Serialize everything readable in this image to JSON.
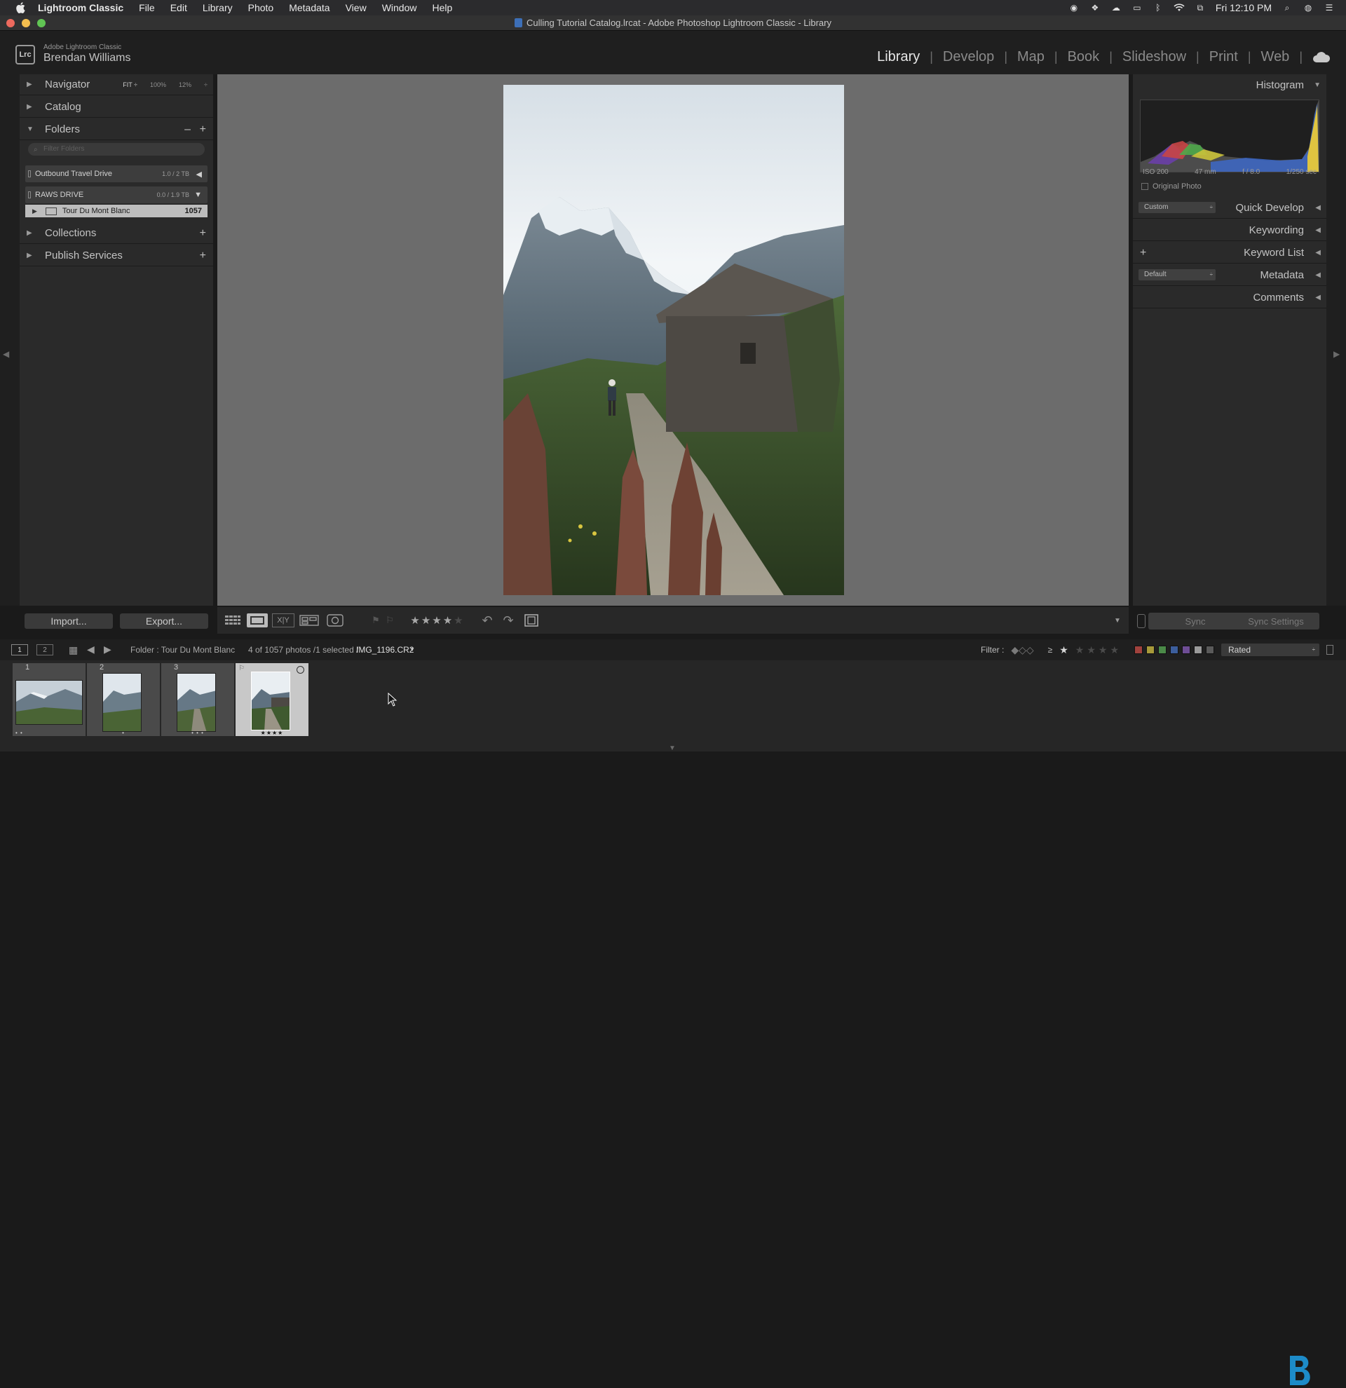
{
  "menubar": {
    "app": "Lightroom Classic",
    "items": [
      "File",
      "Edit",
      "Library",
      "Photo",
      "Metadata",
      "View",
      "Window",
      "Help"
    ],
    "clock": "Fri 12:10 PM"
  },
  "window": {
    "title": "Culling Tutorial Catalog.lrcat - Adobe Photoshop Lightroom Classic - Library"
  },
  "identity": {
    "badge": "Lrc",
    "product": "Adobe Lightroom Classic",
    "user": "Brendan Williams",
    "modules": [
      "Library",
      "Develop",
      "Map",
      "Book",
      "Slideshow",
      "Print",
      "Web"
    ],
    "active_module": "Library"
  },
  "left_panel": {
    "navigator": {
      "label": "Navigator",
      "zoom": [
        "FIT ÷",
        "100%",
        "12%"
      ]
    },
    "catalog": {
      "label": "Catalog"
    },
    "folders": {
      "label": "Folders",
      "filter_placeholder": "Filter Folders",
      "volumes": [
        {
          "name": "Outbound Travel Drive",
          "size": "1.0 / 2 TB",
          "arrow": "◀"
        },
        {
          "name": "RAWS DRIVE",
          "size": "0.0 / 1.9 TB",
          "arrow": "▼"
        }
      ],
      "folder": {
        "name": "Tour Du Mont Blanc",
        "count": "1057"
      }
    },
    "collections": {
      "label": "Collections"
    },
    "publish": {
      "label": "Publish Services"
    },
    "import_label": "Import...",
    "export_label": "Export..."
  },
  "right_panel": {
    "histogram": {
      "label": "Histogram",
      "iso": "ISO 200",
      "focal": "47 mm",
      "aperture": "f / 8.0",
      "shutter": "1/250 sec",
      "original_photo": "Original Photo"
    },
    "quick_develop": {
      "label": "Quick Develop",
      "preset": "Custom"
    },
    "keywording": {
      "label": "Keywording"
    },
    "keyword_list": {
      "label": "Keyword List"
    },
    "metadata": {
      "label": "Metadata",
      "preset": "Default"
    },
    "comments": {
      "label": "Comments"
    },
    "sync_label": "Sync",
    "sync_settings_label": "Sync Settings"
  },
  "filmstrip_header": {
    "screen1": "1",
    "screen2": "2",
    "folder": "Folder : Tour Du Mont Blanc",
    "count": "4 of 1057 photos /1 selected /",
    "filename": "IMG_1196.CR2",
    "filter_label": "Filter :",
    "gte": "≥",
    "rated": "Rated"
  },
  "filmstrip": {
    "cells": [
      {
        "index": "1",
        "stars": "• •",
        "rating": 0
      },
      {
        "index": "2",
        "stars": "•",
        "rating": 0
      },
      {
        "index": "3",
        "stars": "• • •",
        "rating": 0
      },
      {
        "index": "",
        "stars": "★★★★",
        "rating": 4
      }
    ]
  },
  "toolbar": {
    "rating": 4,
    "max_rating": 5
  },
  "colors": {
    "accent_blue": "#1d8bc8",
    "label_red": "#a0423d",
    "label_yellow": "#a89a3a",
    "label_green": "#4b8a48",
    "label_blue": "#3c5e9c",
    "label_purple": "#6e4d95"
  }
}
